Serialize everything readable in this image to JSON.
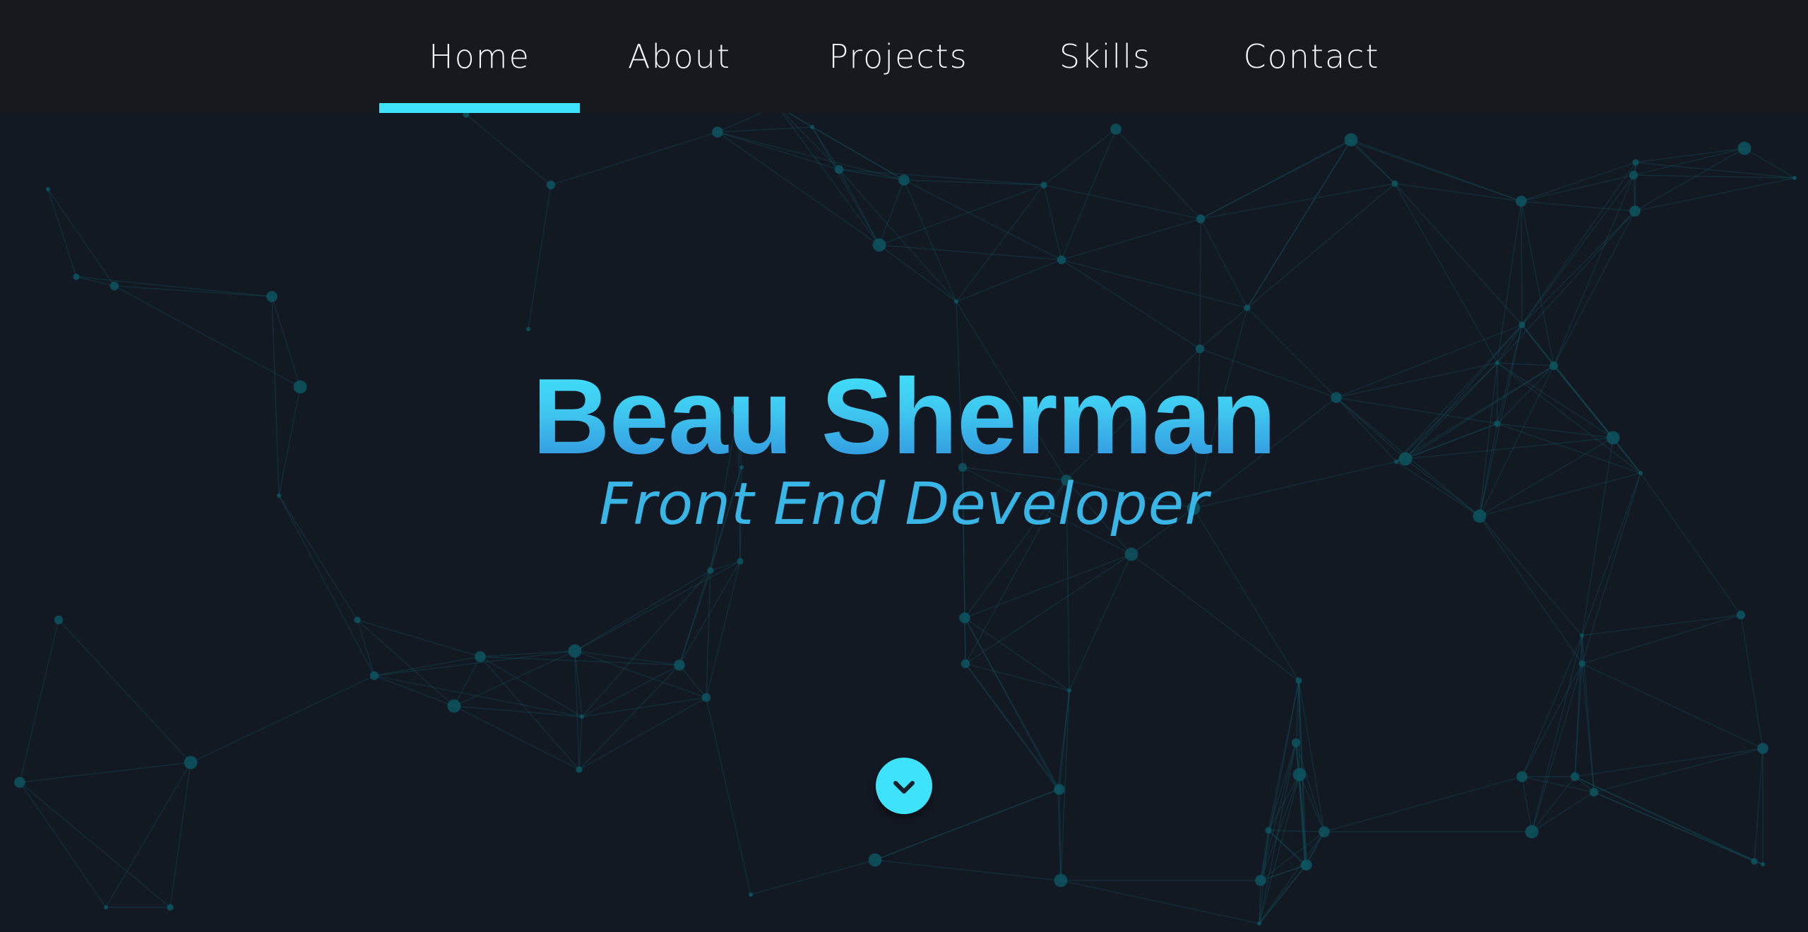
{
  "nav": {
    "items": [
      {
        "label": "Home",
        "active": true
      },
      {
        "label": "About",
        "active": false
      },
      {
        "label": "Projects",
        "active": false
      },
      {
        "label": "Skills",
        "active": false
      },
      {
        "label": "Contact",
        "active": false
      }
    ]
  },
  "hero": {
    "name": "Beau Sherman",
    "role": "Front End Developer"
  },
  "scroll_button": {
    "icon": "chevron-down-icon"
  },
  "background": {
    "type": "particle-network"
  },
  "colors": {
    "background": "#131923",
    "navbar": "#161a1f",
    "accent": "#3ee3fb",
    "title_gradient_top": "#42e7fc",
    "title_gradient_bottom": "#2f8ad9",
    "subtitle": "#39b5e6",
    "particle": "#0d5560"
  }
}
